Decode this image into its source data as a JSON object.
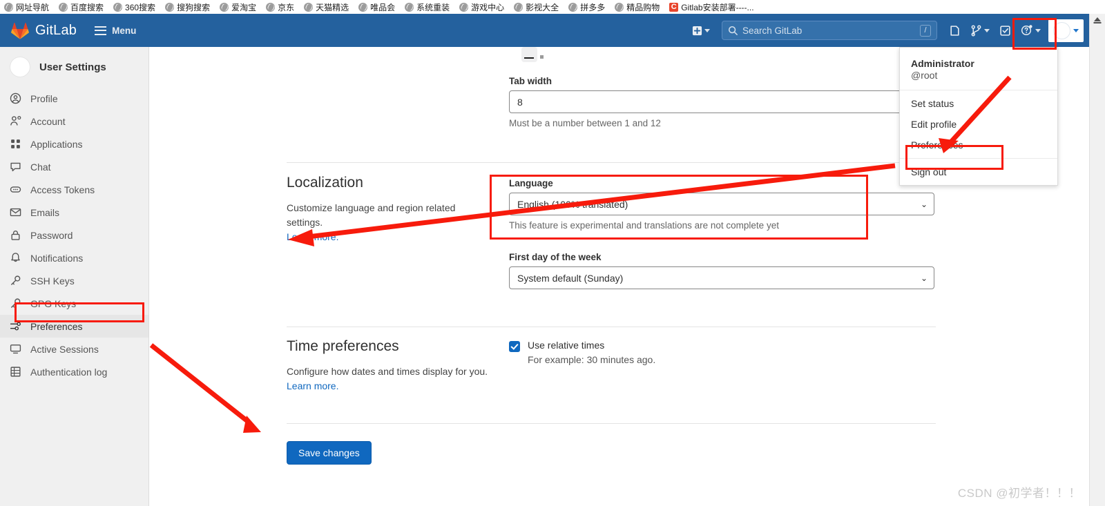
{
  "browser": {
    "bookmarks": [
      {
        "label": "网址导航",
        "icon": "globe-icon"
      },
      {
        "label": "百度搜索",
        "icon": "globe-icon"
      },
      {
        "label": "360搜索",
        "icon": "globe-icon"
      },
      {
        "label": "搜狗搜索",
        "icon": "globe-icon"
      },
      {
        "label": "爱淘宝",
        "icon": "globe-icon"
      },
      {
        "label": "京东",
        "icon": "globe-icon"
      },
      {
        "label": "天猫精选",
        "icon": "globe-icon"
      },
      {
        "label": "唯品会",
        "icon": "globe-icon"
      },
      {
        "label": "系统重装",
        "icon": "globe-icon"
      },
      {
        "label": "游戏中心",
        "icon": "globe-icon"
      },
      {
        "label": "影视大全",
        "icon": "globe-icon"
      },
      {
        "label": "拼多多",
        "icon": "globe-icon"
      },
      {
        "label": "精品购物",
        "icon": "globe-icon"
      },
      {
        "label": "Gitlab安装部署----...",
        "icon": "csdn-c-icon"
      }
    ]
  },
  "navbar": {
    "brand": "GitLab",
    "menu_label": "Menu",
    "search_placeholder": "Search GitLab",
    "search_shortcut": "/",
    "icons": {
      "plus": "plus-square-icon",
      "issues": "issues-icon",
      "merge_requests": "merge-request-icon",
      "todos": "todo-check-icon",
      "help": "question-circle-icon",
      "avatar": "user-avatar"
    },
    "background_color": "#24619e"
  },
  "sidebar": {
    "title": "User Settings",
    "items": [
      {
        "label": "Profile",
        "icon": "user-circle-icon",
        "active": false
      },
      {
        "label": "Account",
        "icon": "account-gear-icon",
        "active": false
      },
      {
        "label": "Applications",
        "icon": "applications-grid-icon",
        "active": false
      },
      {
        "label": "Chat",
        "icon": "chat-bubble-icon",
        "active": false
      },
      {
        "label": "Access Tokens",
        "icon": "token-pill-icon",
        "active": false
      },
      {
        "label": "Emails",
        "icon": "envelope-icon",
        "active": false
      },
      {
        "label": "Password",
        "icon": "lock-icon",
        "active": false
      },
      {
        "label": "Notifications",
        "icon": "bell-icon",
        "active": false
      },
      {
        "label": "SSH Keys",
        "icon": "key-icon",
        "active": false
      },
      {
        "label": "GPG Keys",
        "icon": "key-icon",
        "active": false
      },
      {
        "label": "Preferences",
        "icon": "preferences-sliders-icon",
        "active": true
      },
      {
        "label": "Active Sessions",
        "icon": "monitor-icon",
        "active": false
      },
      {
        "label": "Authentication log",
        "icon": "log-table-icon",
        "active": false
      }
    ]
  },
  "main": {
    "tab_width": {
      "label": "Tab width",
      "value": "8",
      "help": "Must be a number between 1 and 12"
    },
    "localization": {
      "title": "Localization",
      "description": "Customize language and region related settings.",
      "learn_more": "Learn more.",
      "language_label": "Language",
      "language_value": "English (100% translated)",
      "language_help": "This feature is experimental and translations are not complete yet",
      "first_day_label": "First day of the week",
      "first_day_value": "System default (Sunday)"
    },
    "time_preferences": {
      "title": "Time preferences",
      "description": "Configure how dates and times display for you.",
      "learn_more": "Learn more.",
      "checkbox_label": "Use relative times",
      "checkbox_sub": "For example: 30 minutes ago.",
      "checkbox_checked": true
    },
    "save_button": "Save changes"
  },
  "user_dropdown": {
    "name": "Administrator",
    "handle": "@root",
    "items": [
      "Set status",
      "Edit profile",
      "Preferences",
      "Sign out"
    ]
  },
  "annotations": {
    "highlight_color": "#f71b0c",
    "watermark": "CSDN @初学者！！！"
  },
  "colors": {
    "navbar": "#24619e",
    "sidebar": "#f0f0f0",
    "accent_link": "#1068bf",
    "button_primary": "#1068bf",
    "annotation_red": "#f71b0c"
  }
}
